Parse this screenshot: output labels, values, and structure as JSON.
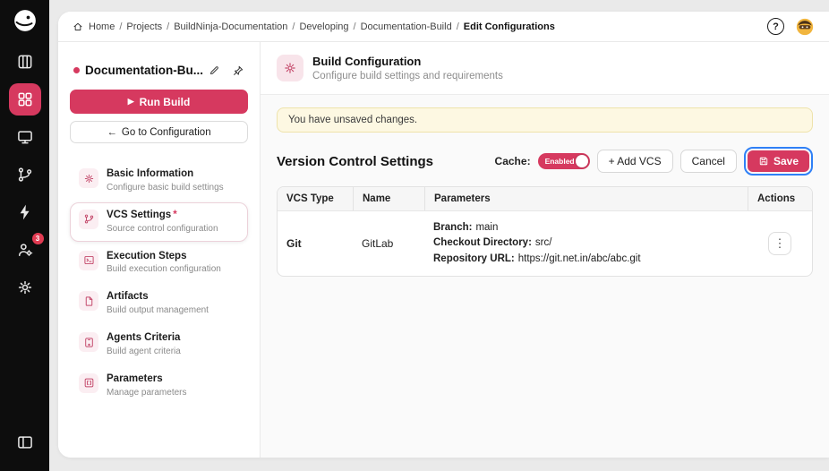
{
  "colors": {
    "accent": "#d6395f",
    "rail_bg": "#0d0d0d",
    "warning_bg": "#fdf8e2",
    "warning_border": "#eee3ab",
    "focus_ring": "#2f80f6",
    "badge": "#e13b52"
  },
  "topbar": {
    "breadcrumb": {
      "separator": "/",
      "items": [
        "Home",
        "Projects",
        "BuildNinja-Documentation",
        "Developing",
        "Documentation-Build",
        "Edit Configurations"
      ]
    },
    "help_label": "?"
  },
  "rail": {
    "badge_count": "3"
  },
  "sidebar": {
    "title": "Documentation-Bu...",
    "run_icon": "▶",
    "run_label": "Run Build",
    "goto_arrow": "←",
    "goto_label": "Go to Configuration",
    "items": [
      {
        "label": "Basic Information",
        "sub": "Configure basic build settings"
      },
      {
        "label": "VCS Settings",
        "required": "*",
        "sub": "Source control configuration"
      },
      {
        "label": "Execution Steps",
        "sub": "Build execution configuration"
      },
      {
        "label": "Artifacts",
        "sub": "Build output management"
      },
      {
        "label": "Agents Criteria",
        "sub": "Build agent criteria"
      },
      {
        "label": "Parameters",
        "sub": "Manage parameters"
      }
    ]
  },
  "header": {
    "title": "Build Configuration",
    "subtitle": "Configure build settings and requirements"
  },
  "main": {
    "warning": "You have unsaved changes.",
    "section_title": "Version Control Settings",
    "cache_label": "Cache:",
    "cache_state": "Enabled",
    "add_vcs_label": "+ Add VCS",
    "cancel_label": "Cancel",
    "save_label": "Save",
    "table": {
      "headers": [
        "VCS Type",
        "Name",
        "Parameters",
        "Actions"
      ],
      "rows": [
        {
          "vcs_type": "Git",
          "name": "GitLab",
          "actions_icon": "⋮",
          "params": [
            {
              "label": "Branch:",
              "value": "main"
            },
            {
              "label": "Checkout Directory:",
              "value": "src/"
            },
            {
              "label": "Repository URL:",
              "value": "https://git.net.in/abc/abc.git"
            }
          ]
        }
      ]
    }
  }
}
